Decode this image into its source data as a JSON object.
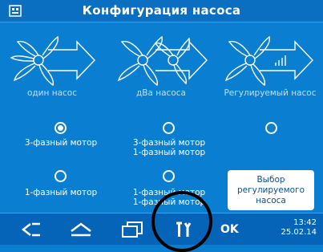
{
  "title": "Конфигурация насоса",
  "pumps": [
    {
      "label": "один насос"
    },
    {
      "label": "дВа насоса"
    },
    {
      "label": "Регулируемый насос"
    }
  ],
  "options": {
    "three_phase": "3-фазный мотор",
    "three_one_line1": "3-фазный мотор",
    "three_one_line2": "1-фазный мотор",
    "one_phase": "1-фазный мотор",
    "one_one_line1": "1-фазный мотор",
    "one_one_line2": "1-фазный мотор"
  },
  "select_button": {
    "line1": "Выбор",
    "line2": "регулируемого",
    "line3": "насоса"
  },
  "toolbar": {
    "ok_label": "OK",
    "time": "13:42",
    "date": "25.02.14"
  },
  "icons": {
    "title": "app-grid-icon",
    "back": "back-arrow-icon",
    "home": "home-icon",
    "windows": "windows-icon",
    "tools": "tools-icon"
  },
  "colors": {
    "background": "#0a7fd1",
    "bar": "#0664b8",
    "label_muted": "#bfe0fa"
  }
}
